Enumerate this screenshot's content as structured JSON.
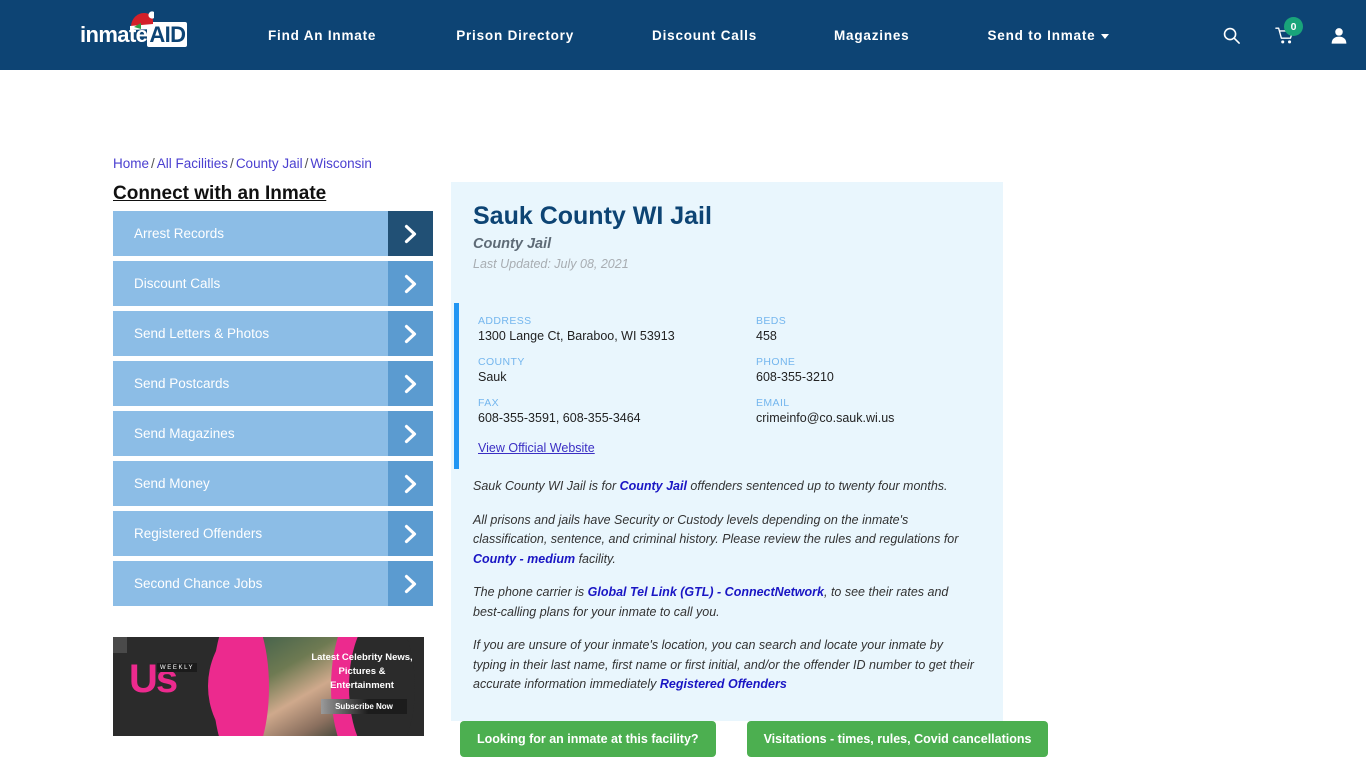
{
  "header": {
    "logo_prefix": "inmate",
    "logo_suffix": "AID",
    "nav_items": [
      {
        "label": "Find An Inmate",
        "has_caret": false
      },
      {
        "label": "Prison Directory",
        "has_caret": false
      },
      {
        "label": "Discount Calls",
        "has_caret": false
      },
      {
        "label": "Magazines",
        "has_caret": false
      },
      {
        "label": "Send to Inmate",
        "has_caret": true
      }
    ],
    "search_icon": "search-icon",
    "cart_icon": "shopping-cart-icon",
    "cart_count": "0",
    "account_icon": "user-account-icon"
  },
  "breadcrumb": {
    "items": [
      "Home",
      "All Facilities",
      "County Jail",
      "Wisconsin"
    ],
    "separator": "/"
  },
  "sidebar": {
    "title": "Connect with an Inmate",
    "items": [
      {
        "label": "Arrest Records"
      },
      {
        "label": "Discount Calls"
      },
      {
        "label": "Send Letters & Photos"
      },
      {
        "label": "Send Postcards"
      },
      {
        "label": "Send Magazines"
      },
      {
        "label": "Send Money"
      },
      {
        "label": "Registered Offenders"
      },
      {
        "label": "Second Chance Jobs"
      }
    ],
    "arrow_icon": "chevron-right-icon"
  },
  "ad": {
    "brand": "Us",
    "brand_sub": "WEEKLY",
    "copy": "Latest Celebrity News, Pictures & Entertainment",
    "button_label": "Subscribe Now"
  },
  "facility": {
    "name": "Sauk County WI Jail",
    "type": "County Jail",
    "last_updated": "Last Updated: July 08, 2021",
    "fields": [
      {
        "label": "ADDRESS",
        "value": "1300 Lange Ct, Baraboo, WI 53913"
      },
      {
        "label": "BEDS",
        "value": "458"
      },
      {
        "label": "COUNTY",
        "value": "Sauk"
      },
      {
        "label": "PHONE",
        "value": "608-355-3210"
      },
      {
        "label": "FAX",
        "value": "608-355-3591, 608-355-3464"
      },
      {
        "label": "EMAIL",
        "value": "crimeinfo@co.sauk.wi.us"
      }
    ],
    "official_website_link": "View Official Website"
  },
  "description": {
    "p1_a": "Sauk County WI Jail is for ",
    "p1_link": "County Jail",
    "p1_b": " offenders sentenced up to twenty four months.",
    "p2_a": "All prisons and jails have Security or Custody levels depending on the inmate's classification, sentence, and criminal history. Please review the rules and regulations for ",
    "p2_link": "County - medium",
    "p2_b": " facility.",
    "p3_a": "The phone carrier is ",
    "p3_link": "Global Tel Link (GTL) - ConnectNetwork",
    "p3_b": ", to see their rates and best-calling plans for your inmate to call you.",
    "p4_a": "If you are unsure of your inmate's location, you can search and locate your inmate by typing in their last name, first name or first initial, and/or the offender ID number to get their accurate information immediately ",
    "p4_link": "Registered Offenders"
  },
  "cta": {
    "primary_label": "Looking for an inmate at this facility?",
    "secondary_label": "Visitations - times, rules, Covid cancellations"
  },
  "colors": {
    "header_blue": "#0d4474",
    "panel_blue": "#e9f6fd",
    "accent_blue": "#2196f3",
    "sidebar_item": "#8cbde6",
    "sidebar_arrow": "#5b9bd0",
    "sidebar_arrow_active": "#215075",
    "cta_green": "#4caf50",
    "badge_green": "#19a47a",
    "link_purple": "#4a3fd0"
  }
}
